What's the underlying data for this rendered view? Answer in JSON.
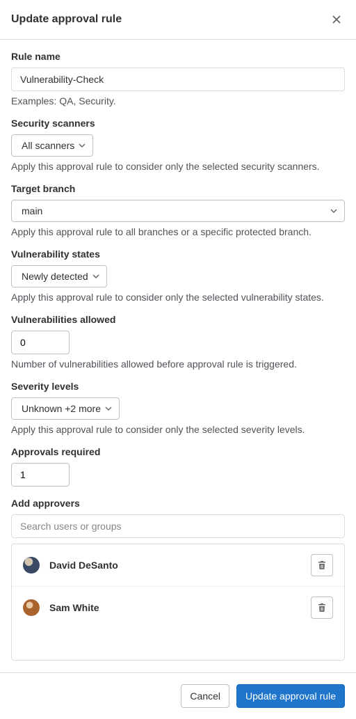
{
  "modal": {
    "title": "Update approval rule"
  },
  "fields": {
    "rule_name": {
      "label": "Rule name",
      "value": "Vulnerability-Check",
      "help": "Examples: QA, Security."
    },
    "security_scanners": {
      "label": "Security scanners",
      "selected": "All scanners",
      "help": "Apply this approval rule to consider only the selected security scanners."
    },
    "target_branch": {
      "label": "Target branch",
      "selected": "main",
      "help": "Apply this approval rule to all branches or a specific protected branch."
    },
    "vulnerability_states": {
      "label": "Vulnerability states",
      "selected": "Newly detected",
      "help": "Apply this approval rule to consider only the selected vulnerability states."
    },
    "vulnerabilities_allowed": {
      "label": "Vulnerabilities allowed",
      "value": "0",
      "help": "Number of vulnerabilities allowed before approval rule is triggered."
    },
    "severity_levels": {
      "label": "Severity levels",
      "selected": "Unknown +2 more",
      "help": "Apply this approval rule to consider only the selected severity levels."
    },
    "approvals_required": {
      "label": "Approvals required",
      "value": "1"
    },
    "add_approvers": {
      "label": "Add approvers",
      "placeholder": "Search users or groups"
    }
  },
  "approvers": [
    {
      "name": "David DeSanto"
    },
    {
      "name": "Sam White"
    }
  ],
  "footer": {
    "cancel": "Cancel",
    "submit": "Update approval rule"
  }
}
